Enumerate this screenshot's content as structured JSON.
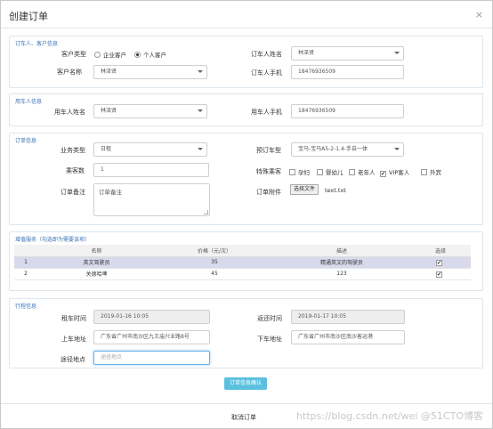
{
  "modal": {
    "title": "创建订单",
    "close_label": "×"
  },
  "customer": {
    "section_title": "订车人、客户信息",
    "type_label": "客户类型",
    "type_options": [
      "企业客户",
      "个人客户"
    ],
    "type_selected": "个人客户",
    "name_label": "客户名称",
    "name_value": "林泽贤",
    "booker_name_label": "订车人姓名",
    "booker_name_value": "林泽贤",
    "booker_phone_label": "订车人手机",
    "booker_phone_value": "18476936509"
  },
  "user": {
    "section_title": "用车人信息",
    "name_label": "用车人姓名",
    "name_value": "林泽贤",
    "phone_label": "用车人手机",
    "phone_value": "18476936509"
  },
  "order": {
    "section_title": "订单信息",
    "biz_type_label": "业务类型",
    "biz_type_value": "日租",
    "car_model_label": "预订车型",
    "car_model_value": "宝马-宝马A5-2-1.4-手自一体",
    "passengers_label": "乘客数",
    "passengers_value": "1",
    "special_label": "特殊乘客",
    "special_options": [
      {
        "label": "孕妇",
        "checked": false
      },
      {
        "label": "婴幼儿",
        "checked": false
      },
      {
        "label": "老年人",
        "checked": false
      },
      {
        "label": "VIP客人",
        "checked": true
      },
      {
        "label": "外宾",
        "checked": false
      }
    ],
    "remark_label": "订单备注",
    "remark_value": "订单备注",
    "attachment_label": "订单附件",
    "file_button": "选择文件",
    "file_name": "text.txt"
  },
  "services": {
    "section_title": "增值服务（勾选即为需要该项）",
    "columns": [
      "",
      "名称",
      "价格（元/次）",
      "描述",
      "选择"
    ],
    "rows": [
      {
        "no": "1",
        "name": "英文驾驶员",
        "price": "35",
        "desc": "精通英文的驾驶员",
        "checked": true
      },
      {
        "no": "2",
        "name": "关德哈啤",
        "price": "45",
        "desc": "123",
        "checked": true
      }
    ]
  },
  "trip": {
    "section_title": "行程信息",
    "rent_time_label": "租车时间",
    "rent_time_value": "2019-01-16 10:05",
    "return_time_label": "返还时间",
    "return_time_value": "2019-01-17 10:05",
    "pickup_label": "上车地址",
    "pickup_value": "广东省广州市南沙区九王庙兴业路8号",
    "dropoff_label": "下车地址",
    "dropoff_value": "广东省广州市南沙区南沙客运港",
    "via_label": "途径地点",
    "via_placeholder": "途径地点"
  },
  "actions": {
    "confirm_label": "订单信息确认",
    "cancel_label": "取消订单"
  },
  "watermark": "https://blog.csdn.net/wei @51CTO博客"
}
